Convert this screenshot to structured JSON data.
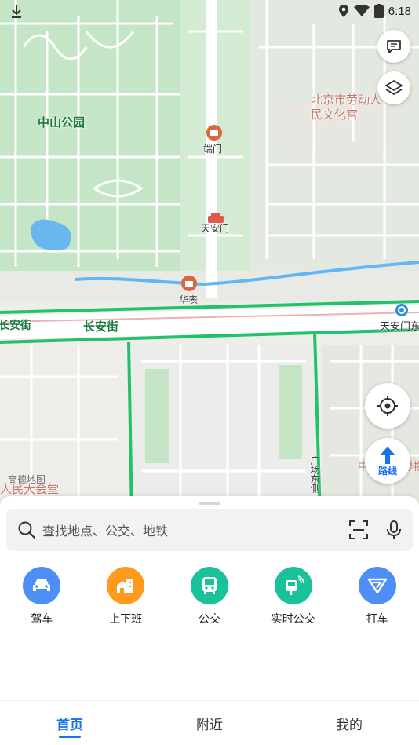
{
  "status": {
    "time": "6:18",
    "icons": [
      "download-icon",
      "location-icon",
      "wifi-icon",
      "battery-icon"
    ]
  },
  "map": {
    "labels": {
      "park": "中山公园",
      "duanmen": "端门",
      "tiananmen": "天安门",
      "huabiao": "华表",
      "changan_left": "长安街",
      "changan_center": "长安街",
      "tiananmen_east": "天安门东",
      "workers_palace": "北京市劳动人民文化宫",
      "square_east": "广场东侧",
      "great_hall": "人民大会堂",
      "logo": "高德地图",
      "museum_hint": "中国国家博物馆"
    },
    "route_button": "路线"
  },
  "search": {
    "placeholder": "查找地点、公交、地铁"
  },
  "quick_actions": [
    {
      "label": "驾车",
      "icon": "car-icon",
      "color": "#4d8ef7"
    },
    {
      "label": "上下班",
      "icon": "home-office-icon",
      "color": "#ff9a1f"
    },
    {
      "label": "公交",
      "icon": "bus-icon",
      "color": "#1ac29a"
    },
    {
      "label": "实时公交",
      "icon": "realtime-bus-icon",
      "color": "#1ac29a"
    },
    {
      "label": "打车",
      "icon": "taxi-icon",
      "color": "#4d8ef7"
    }
  ],
  "tabs": [
    {
      "label": "首页",
      "active": true
    },
    {
      "label": "附近",
      "active": false
    },
    {
      "label": "我的",
      "active": false
    }
  ],
  "colors": {
    "accent": "#1a73e8",
    "road_green": "#22c16b",
    "park_green": "#c7e8c9"
  }
}
